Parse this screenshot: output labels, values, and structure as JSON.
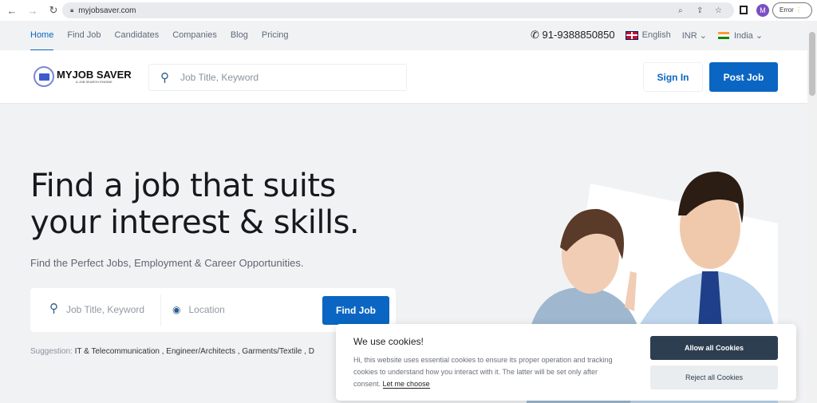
{
  "browser": {
    "url": "myjobsaver.com",
    "profile_initial": "M",
    "error_label": "Error"
  },
  "topnav": {
    "links": [
      "Home",
      "Find Job",
      "Candidates",
      "Companies",
      "Blog",
      "Pricing"
    ],
    "phone": "91-9388850850",
    "language": "English",
    "currency": "INR",
    "country": "India"
  },
  "header": {
    "logo_title": "MYJOB SAVER",
    "logo_tagline": "A JOB SEARCH ENGINE",
    "search_placeholder": "Job Title, Keyword",
    "signin": "Sign In",
    "post_job": "Post Job"
  },
  "hero": {
    "title_line1": "Find a job that suits",
    "title_line2": "your interest & skills.",
    "subtitle": "Find the Perfect Jobs, Employment & Career Opportunities.",
    "job_placeholder": "Job Title, Keyword",
    "location_placeholder": "Location",
    "find_button": "Find Job",
    "suggestion_label": "Suggestion:",
    "suggestions": "IT & Telecommunication ,  Engineer/Architects ,  Garments/Textile ,  D"
  },
  "cookie": {
    "title": "We use cookies!",
    "text": "Hi, this website uses essential cookies to ensure its proper operation and tracking cookies to understand how you interact with it. The latter will be set only after consent.",
    "link": "Let me choose",
    "allow": "Allow all Cookies",
    "reject": "Reject all Cookies"
  },
  "colors": {
    "primary": "#0a66c2",
    "dark": "#2d3e50"
  }
}
